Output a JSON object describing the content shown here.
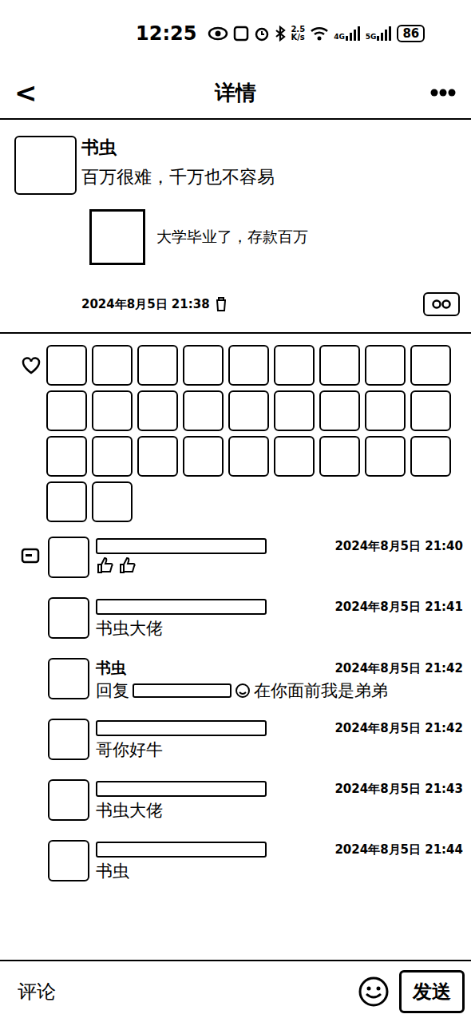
{
  "status_bar": {
    "time": "12:25",
    "speed": "2.5",
    "speed_unit": "K/s",
    "networks": [
      "4G",
      "5G"
    ],
    "battery": "86"
  },
  "header": {
    "back": "<",
    "title": "详情"
  },
  "post": {
    "author": "书虫",
    "text": "百万很难，千万也不容易",
    "link": {
      "title": "大学毕业了，存款百万"
    },
    "time": "2024年8月5日 21:38"
  },
  "like_avatars": 29,
  "comments": [
    {
      "name": "",
      "name_hidden": true,
      "time": "2024年8月5日 21:40",
      "text": "",
      "thumbs": 2,
      "reply_to_hidden": false,
      "reply_prefix": ""
    },
    {
      "name": "",
      "name_hidden": true,
      "time": "2024年8月5日 21:41",
      "text": "书虫大佬",
      "thumbs": 0,
      "reply_to_hidden": false,
      "reply_prefix": ""
    },
    {
      "name": "书虫",
      "name_hidden": false,
      "time": "2024年8月5日 21:42",
      "text": "在你面前我是弟弟",
      "thumbs": 0,
      "reply_to_hidden": true,
      "reply_prefix": "回复"
    },
    {
      "name": "",
      "name_hidden": true,
      "time": "2024年8月5日 21:42",
      "text": "哥你好牛",
      "thumbs": 0,
      "reply_to_hidden": false,
      "reply_prefix": ""
    },
    {
      "name": "",
      "name_hidden": true,
      "time": "2024年8月5日 21:43",
      "text": "书虫大佬",
      "thumbs": 0,
      "reply_to_hidden": false,
      "reply_prefix": ""
    },
    {
      "name": "",
      "name_hidden": true,
      "time": "2024年8月5日 21:44",
      "text": "书虫",
      "thumbs": 0,
      "reply_to_hidden": false,
      "reply_prefix": ""
    }
  ],
  "input": {
    "placeholder": "评论"
  },
  "send_button": "发送"
}
